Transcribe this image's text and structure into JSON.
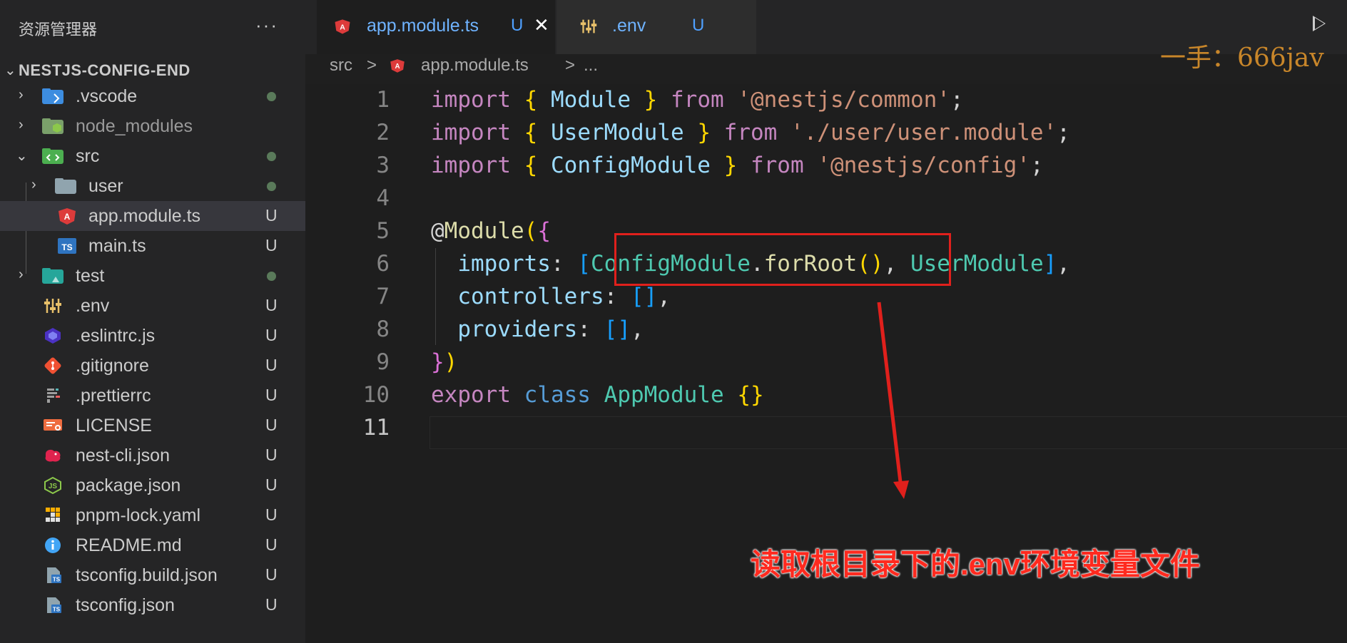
{
  "sidebar": {
    "title": "资源管理器",
    "more_label": "···",
    "root_label": "NESTJS-CONFIG-END",
    "items": [
      {
        "label": ".vscode",
        "status": "dot"
      },
      {
        "label": "node_modules",
        "status": ""
      },
      {
        "label": "src",
        "status": "dot"
      },
      {
        "label": "user",
        "status": "dot"
      },
      {
        "label": "app.module.ts",
        "status": "U"
      },
      {
        "label": "main.ts",
        "status": "U"
      },
      {
        "label": "test",
        "status": "dot"
      },
      {
        "label": ".env",
        "status": "U"
      },
      {
        "label": ".eslintrc.js",
        "status": "U"
      },
      {
        "label": ".gitignore",
        "status": "U"
      },
      {
        "label": ".prettierrc",
        "status": "U"
      },
      {
        "label": "LICENSE",
        "status": "U"
      },
      {
        "label": "nest-cli.json",
        "status": "U"
      },
      {
        "label": "package.json",
        "status": "U"
      },
      {
        "label": "pnpm-lock.yaml",
        "status": "U"
      },
      {
        "label": "README.md",
        "status": "U"
      },
      {
        "label": "tsconfig.build.json",
        "status": "U"
      },
      {
        "label": "tsconfig.json",
        "status": "U"
      }
    ]
  },
  "tabs": [
    {
      "label": "app.module.ts",
      "badge": "U",
      "close": "✕"
    },
    {
      "label": ".env",
      "badge": "U"
    }
  ],
  "watermark": "一手：666jav",
  "breadcrumb": {
    "folder": "src",
    "sep": ">",
    "file": "app.module.ts",
    "sep2": ">",
    "more": "..."
  },
  "editor": {
    "line_numbers": [
      "1",
      "2",
      "3",
      "4",
      "5",
      "6",
      "7",
      "8",
      "9",
      "10",
      "11"
    ],
    "current_line": "11"
  },
  "annotation": "读取根目录下的.env环境变量文件",
  "colors": {
    "highlight": "#e0201c",
    "annotation": "#ff2a1f",
    "badge_untracked": "#4fa0ff"
  }
}
